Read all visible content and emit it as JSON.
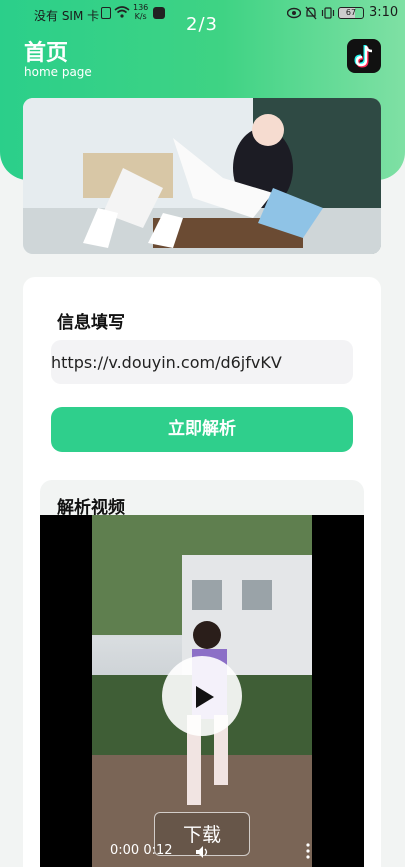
{
  "status_bar": {
    "carrier": "没有 SIM 卡",
    "speed_value": "136",
    "speed_unit": "K/s",
    "battery": "67",
    "time": "3:10"
  },
  "page_indicator": "2/3",
  "header": {
    "title": "首页",
    "subtitle": "home page"
  },
  "form": {
    "section_title": "信息填写",
    "url_value": "https://v.douyin.com/d6jfvKV",
    "parse_label": "立即解析"
  },
  "video": {
    "section_title": "解析视频",
    "download_label": "下载",
    "time_readout": "0:00 0:12"
  },
  "colors": {
    "accent": "#2fcf8c",
    "header_gradient_start": "#2bcf8a",
    "header_gradient_end": "#7fe0a4"
  },
  "icons": [
    "sim-icon",
    "wifi-icon",
    "message-icon",
    "eye-icon",
    "bell-off-icon",
    "vibrate-icon",
    "battery-icon",
    "tiktok-icon",
    "play-icon",
    "volume-icon",
    "more-icon"
  ]
}
